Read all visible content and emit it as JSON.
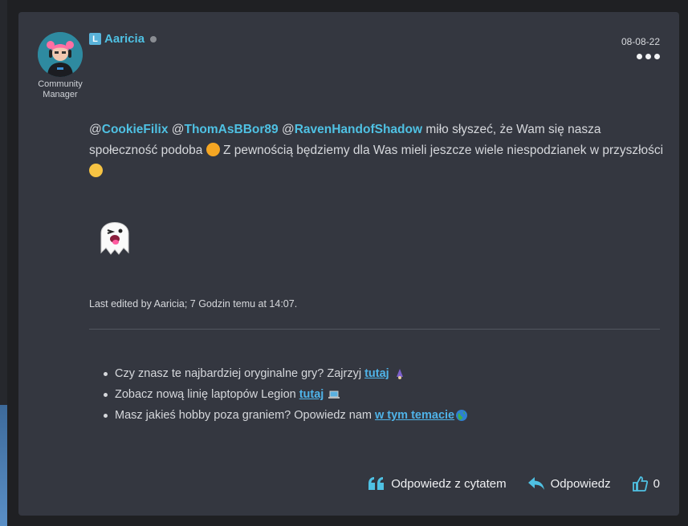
{
  "post": {
    "username": "Aaricia",
    "badge_letter": "L",
    "role": "Community Manager",
    "date": "08-08-22",
    "mentions": [
      "@",
      "CookieFilix",
      "@",
      "ThomAsBBor89",
      "@",
      "RavenHandofShadow"
    ],
    "text_part1": " miło słyszeć, że Wam się nasza społeczność podoba ",
    "text_part2": " Z pewnością będziemy dla Was mieli jeszcze wiele niespodzianek w przyszłości ",
    "edited_note": "Last edited by Aaricia; 7 Godzin temu at 14:07."
  },
  "signature": {
    "items": [
      {
        "text": "Czy znasz te najbardziej oryginalne gry? Zajrzyj ",
        "link": "tutaj",
        "icon": "wizard-icon"
      },
      {
        "text": "Zobacz nową linię laptopów Legion ",
        "link": "tutaj",
        "icon": "laptop-icon"
      },
      {
        "text": "Masz jakieś hobby poza graniem? Opowiedz nam ",
        "link": "w tym temacie",
        "icon": "globe-icon"
      }
    ]
  },
  "actions": {
    "quote_reply": "Odpowiedz z cytatem",
    "reply": "Odpowiedz",
    "likes": "0"
  },
  "colors": {
    "accent": "#4fc1e3",
    "link": "#4fb3e8",
    "card_bg": "#343740",
    "page_bg": "#1f2023"
  }
}
